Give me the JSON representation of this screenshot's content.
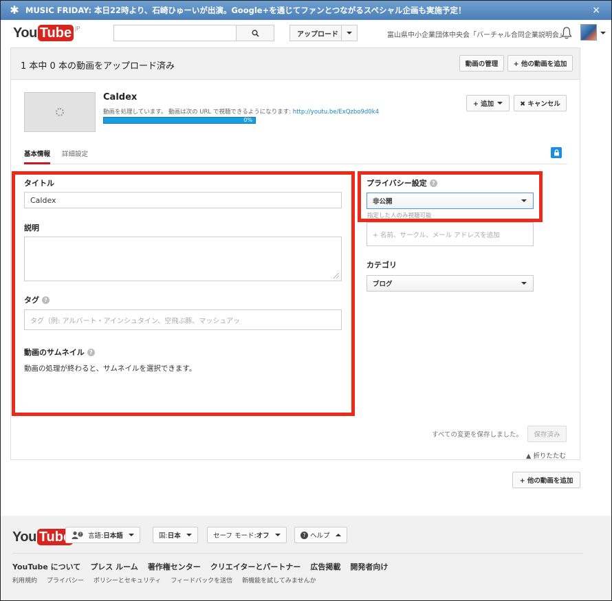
{
  "banner": {
    "text": "MUSIC FRIDAY: 本日22時より、石崎ひゅーいが出演。Google+を通じてファンとつながるスペシャル企画も実施予定！",
    "close": "×"
  },
  "header": {
    "logo_you": "You",
    "logo_tube": "Tube",
    "logo_region": "JP",
    "upload_label": "アップロード",
    "channel_name": "富山県中小企業団体中央会「バーチャル合同企業説明会」"
  },
  "upload_page": {
    "count_text": "1 本中 0 本の動画をアップロード済み",
    "manage_label": "動画の管理",
    "add_more_label": "+ 他の動画を追加"
  },
  "video": {
    "title": "Caldex",
    "status_prefix": "動画を処理しています。 動画は次の URL で視聴できるようになります: ",
    "url": "http://youtu.be/ExQzbo9d0k4",
    "progress_text": "0%",
    "progress_value": 0.0,
    "add_label": "+ 追加",
    "cancel_label": "✖ キャンセル"
  },
  "tabs": [
    {
      "label": "基本情報"
    },
    {
      "label": "詳細設定"
    }
  ],
  "form": {
    "title_label": "タイトル",
    "title_value": "Caldex",
    "desc_label": "説明",
    "tags_label": "タグ",
    "tags_placeholder": "タグ（例: アルバート・アインシュタイン、空飛ぶ豚、マッシュアッ",
    "thumb_label": "動画のサムネイル",
    "thumb_note": "動画の処理が終わると、サムネイルを選択できます。"
  },
  "privacy": {
    "label": "プライバシー設定",
    "value": "非公開",
    "note": "指定した人のみ視聴可能",
    "share_placeholder": "+ 名前、サークル、メール アドレスを追加",
    "category_label": "カテゴリ",
    "category_value": "ブログ"
  },
  "save": {
    "status": "すべての変更を保存しました。",
    "button": "保存済み",
    "collapse": "▲ 折りたたむ"
  },
  "bottom_add": "+ 他の動画を追加",
  "footer": {
    "logo_you": "You",
    "logo_tube": "Tube",
    "language_prefix": "言語: ",
    "language_value": "日本語",
    "country_prefix": "国: ",
    "country_value": "日本",
    "safe_prefix": "セーフ モード: ",
    "safe_value": "オフ",
    "help_label": "ヘルプ",
    "links": [
      "YouTube について",
      "プレス ルーム",
      "著作権センター",
      "クリエイターとパートナー",
      "広告掲載",
      "開発者向け"
    ],
    "links2": [
      "利用規約",
      "プライバシー",
      "ポリシーとセキュリティ",
      "フィードバックを送信",
      "新機能を試してみませんか"
    ]
  },
  "colors": {
    "banner": "#5b8ec6",
    "progress": "#1a9ce0",
    "highlight_box": "#ec2a1a",
    "youtube_red": "#d8261f"
  }
}
